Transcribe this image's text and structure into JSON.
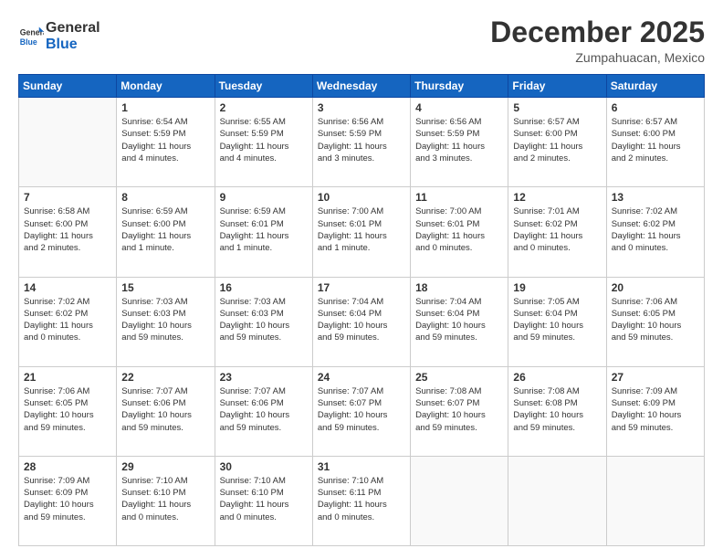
{
  "header": {
    "logo_general": "General",
    "logo_blue": "Blue",
    "month": "December 2025",
    "location": "Zumpahuacan, Mexico"
  },
  "weekdays": [
    "Sunday",
    "Monday",
    "Tuesday",
    "Wednesday",
    "Thursday",
    "Friday",
    "Saturday"
  ],
  "weeks": [
    [
      {
        "day": "",
        "info": ""
      },
      {
        "day": "1",
        "info": "Sunrise: 6:54 AM\nSunset: 5:59 PM\nDaylight: 11 hours\nand 4 minutes."
      },
      {
        "day": "2",
        "info": "Sunrise: 6:55 AM\nSunset: 5:59 PM\nDaylight: 11 hours\nand 4 minutes."
      },
      {
        "day": "3",
        "info": "Sunrise: 6:56 AM\nSunset: 5:59 PM\nDaylight: 11 hours\nand 3 minutes."
      },
      {
        "day": "4",
        "info": "Sunrise: 6:56 AM\nSunset: 5:59 PM\nDaylight: 11 hours\nand 3 minutes."
      },
      {
        "day": "5",
        "info": "Sunrise: 6:57 AM\nSunset: 6:00 PM\nDaylight: 11 hours\nand 2 minutes."
      },
      {
        "day": "6",
        "info": "Sunrise: 6:57 AM\nSunset: 6:00 PM\nDaylight: 11 hours\nand 2 minutes."
      }
    ],
    [
      {
        "day": "7",
        "info": "Sunrise: 6:58 AM\nSunset: 6:00 PM\nDaylight: 11 hours\nand 2 minutes."
      },
      {
        "day": "8",
        "info": "Sunrise: 6:59 AM\nSunset: 6:00 PM\nDaylight: 11 hours\nand 1 minute."
      },
      {
        "day": "9",
        "info": "Sunrise: 6:59 AM\nSunset: 6:01 PM\nDaylight: 11 hours\nand 1 minute."
      },
      {
        "day": "10",
        "info": "Sunrise: 7:00 AM\nSunset: 6:01 PM\nDaylight: 11 hours\nand 1 minute."
      },
      {
        "day": "11",
        "info": "Sunrise: 7:00 AM\nSunset: 6:01 PM\nDaylight: 11 hours\nand 0 minutes."
      },
      {
        "day": "12",
        "info": "Sunrise: 7:01 AM\nSunset: 6:02 PM\nDaylight: 11 hours\nand 0 minutes."
      },
      {
        "day": "13",
        "info": "Sunrise: 7:02 AM\nSunset: 6:02 PM\nDaylight: 11 hours\nand 0 minutes."
      }
    ],
    [
      {
        "day": "14",
        "info": "Sunrise: 7:02 AM\nSunset: 6:02 PM\nDaylight: 11 hours\nand 0 minutes."
      },
      {
        "day": "15",
        "info": "Sunrise: 7:03 AM\nSunset: 6:03 PM\nDaylight: 10 hours\nand 59 minutes."
      },
      {
        "day": "16",
        "info": "Sunrise: 7:03 AM\nSunset: 6:03 PM\nDaylight: 10 hours\nand 59 minutes."
      },
      {
        "day": "17",
        "info": "Sunrise: 7:04 AM\nSunset: 6:04 PM\nDaylight: 10 hours\nand 59 minutes."
      },
      {
        "day": "18",
        "info": "Sunrise: 7:04 AM\nSunset: 6:04 PM\nDaylight: 10 hours\nand 59 minutes."
      },
      {
        "day": "19",
        "info": "Sunrise: 7:05 AM\nSunset: 6:04 PM\nDaylight: 10 hours\nand 59 minutes."
      },
      {
        "day": "20",
        "info": "Sunrise: 7:06 AM\nSunset: 6:05 PM\nDaylight: 10 hours\nand 59 minutes."
      }
    ],
    [
      {
        "day": "21",
        "info": "Sunrise: 7:06 AM\nSunset: 6:05 PM\nDaylight: 10 hours\nand 59 minutes."
      },
      {
        "day": "22",
        "info": "Sunrise: 7:07 AM\nSunset: 6:06 PM\nDaylight: 10 hours\nand 59 minutes."
      },
      {
        "day": "23",
        "info": "Sunrise: 7:07 AM\nSunset: 6:06 PM\nDaylight: 10 hours\nand 59 minutes."
      },
      {
        "day": "24",
        "info": "Sunrise: 7:07 AM\nSunset: 6:07 PM\nDaylight: 10 hours\nand 59 minutes."
      },
      {
        "day": "25",
        "info": "Sunrise: 7:08 AM\nSunset: 6:07 PM\nDaylight: 10 hours\nand 59 minutes."
      },
      {
        "day": "26",
        "info": "Sunrise: 7:08 AM\nSunset: 6:08 PM\nDaylight: 10 hours\nand 59 minutes."
      },
      {
        "day": "27",
        "info": "Sunrise: 7:09 AM\nSunset: 6:09 PM\nDaylight: 10 hours\nand 59 minutes."
      }
    ],
    [
      {
        "day": "28",
        "info": "Sunrise: 7:09 AM\nSunset: 6:09 PM\nDaylight: 10 hours\nand 59 minutes."
      },
      {
        "day": "29",
        "info": "Sunrise: 7:10 AM\nSunset: 6:10 PM\nDaylight: 11 hours\nand 0 minutes."
      },
      {
        "day": "30",
        "info": "Sunrise: 7:10 AM\nSunset: 6:10 PM\nDaylight: 11 hours\nand 0 minutes."
      },
      {
        "day": "31",
        "info": "Sunrise: 7:10 AM\nSunset: 6:11 PM\nDaylight: 11 hours\nand 0 minutes."
      },
      {
        "day": "",
        "info": ""
      },
      {
        "day": "",
        "info": ""
      },
      {
        "day": "",
        "info": ""
      }
    ]
  ]
}
